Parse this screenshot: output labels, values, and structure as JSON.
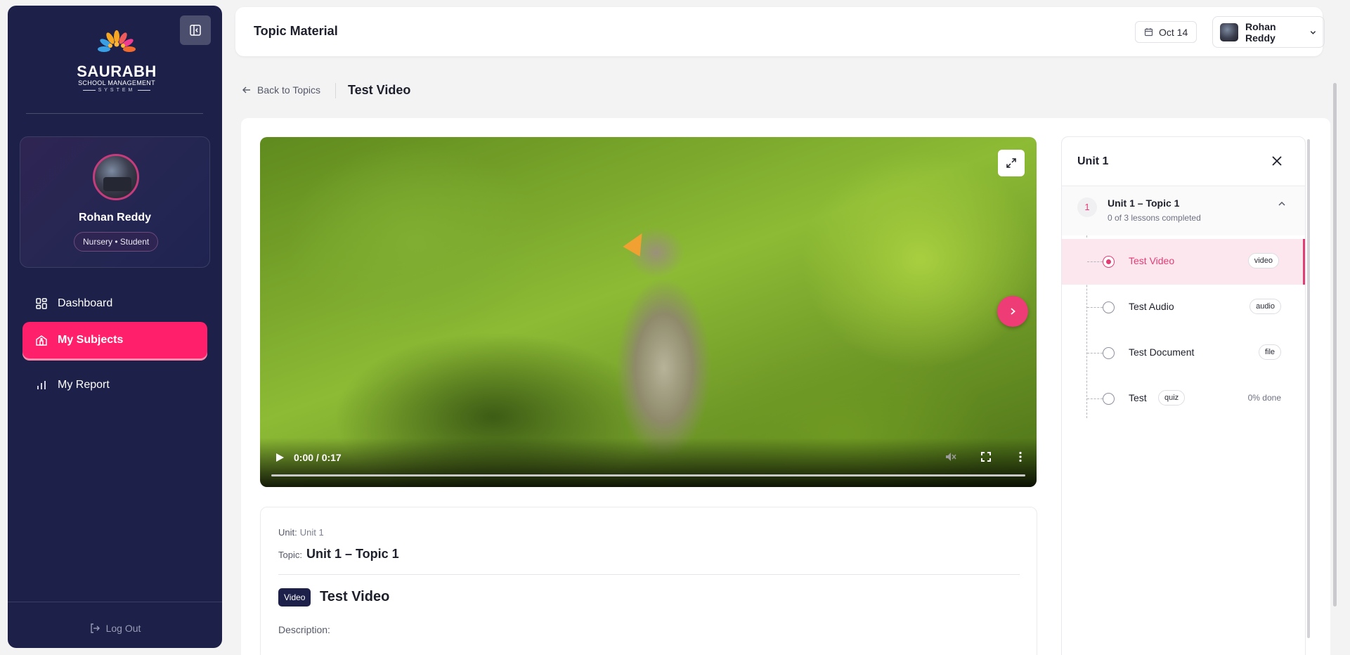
{
  "brand": {
    "name": "SAURABH",
    "subtitle": "SCHOOL MANAGEMENT",
    "tagline": "SYSTEM",
    "accent_color": "#ff1f6b",
    "sidebar_color": "#1d2049"
  },
  "profile": {
    "name": "Rohan Reddy",
    "role": "Nursery • Student"
  },
  "nav": {
    "items": [
      {
        "label": "Dashboard",
        "icon": "dashboard-grid-icon",
        "active": false
      },
      {
        "label": "My Subjects",
        "icon": "subjects-icon",
        "active": true
      },
      {
        "label": "My Report",
        "icon": "bar-chart-icon",
        "active": false
      }
    ],
    "logout_label": "Log Out"
  },
  "header": {
    "title": "Topic Material",
    "date": "Oct 14",
    "user_name": "Rohan Reddy"
  },
  "breadcrumb": {
    "back_label": "Back to Topics",
    "current": "Test Video"
  },
  "video": {
    "time": "0:00 / 0:17",
    "progress": 0
  },
  "info": {
    "unit_label": "Unit:",
    "unit_value": "Unit 1",
    "topic_label": "Topic:",
    "topic_value": "Unit 1 – Topic 1",
    "type_badge": "Video",
    "title": "Test Video",
    "description_label": "Description:"
  },
  "panel": {
    "title": "Unit 1",
    "topic": {
      "number": "1",
      "name": "Unit 1 – Topic 1",
      "meta": "0 of 3 lessons completed"
    },
    "lessons": [
      {
        "name": "Test Video",
        "tag": "video",
        "active": true
      },
      {
        "name": "Test Audio",
        "tag": "audio",
        "active": false
      },
      {
        "name": "Test Document",
        "tag": "file",
        "active": false
      },
      {
        "name": "Test",
        "tag": "quiz",
        "done": "0% done",
        "active": false
      }
    ]
  }
}
